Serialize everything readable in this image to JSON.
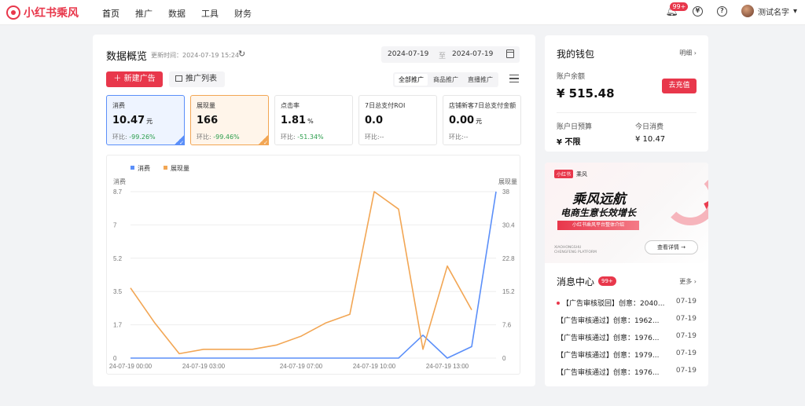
{
  "app": {
    "logo_text": "小红书乘风",
    "brand_color": "#e8374b"
  },
  "nav": {
    "items": [
      "首页",
      "推广",
      "数据",
      "工具",
      "财务"
    ]
  },
  "header": {
    "notification_count": "99+",
    "user_name": "测试名字"
  },
  "overview": {
    "title": "数据概览",
    "update_time": "更新时间：2024-07-19 15:24",
    "date_start": "2024-07-19",
    "date_sep": "至",
    "date_end": "2024-07-19",
    "new_ad_label": "新建广告",
    "promo_list_label": "推广列表",
    "filters": [
      "全部推广",
      "商品推广",
      "直播推广"
    ]
  },
  "metrics": [
    {
      "label": "消费",
      "value": "10.47",
      "unit": "元",
      "compare_label": "环比:",
      "compare_value": "-99.26%"
    },
    {
      "label": "展现量",
      "value": "166",
      "unit": "",
      "compare_label": "环比:",
      "compare_value": "-99.46%"
    },
    {
      "label": "点击率",
      "value": "1.81",
      "unit": "%",
      "compare_label": "环比:",
      "compare_value": "-51.34%"
    },
    {
      "label": "7日总支付ROI",
      "value": "0.0",
      "unit": "",
      "compare_label": "环比:",
      "compare_value": "--"
    },
    {
      "label": "店铺新客7日总支付金额",
      "value": "0.00",
      "unit": "元",
      "compare_label": "环比:",
      "compare_value": "--"
    }
  ],
  "chart_data": {
    "type": "line",
    "x": [
      "24-07-19 00:00",
      "24-07-19 01:00",
      "24-07-19 02:00",
      "24-07-19 03:00",
      "24-07-19 04:00",
      "24-07-19 05:00",
      "24-07-19 06:00",
      "24-07-19 07:00",
      "24-07-19 08:00",
      "24-07-19 09:00",
      "24-07-19 10:00",
      "24-07-19 11:00",
      "24-07-19 12:00",
      "24-07-19 13:00",
      "24-07-19 14:00",
      "24-07-19 15:00"
    ],
    "x_tick_labels": [
      "24-07-19 00:00",
      "24-07-19 03:00",
      "24-07-19 07:00",
      "24-07-19 10:00",
      "24-07-19 13:00"
    ],
    "x_tick_indices": [
      0,
      3,
      7,
      10,
      13
    ],
    "series": [
      {
        "name": "消费",
        "axis": "left",
        "color": "#5b8ff9",
        "values": [
          0,
          0,
          0,
          0,
          0,
          0,
          0,
          0,
          0,
          0,
          0,
          0,
          1.2,
          0,
          0.6,
          8.7
        ]
      },
      {
        "name": "展现量",
        "axis": "right",
        "color": "#f2a654",
        "values": [
          16,
          8,
          1,
          2,
          2,
          2,
          3,
          5,
          8,
          10,
          38,
          34,
          2,
          21,
          11
        ]
      }
    ],
    "ylabel_left": "消费",
    "ylabel_right": "展现量",
    "yticks_left": [
      "0",
      "1.7",
      "3.5",
      "5.2",
      "7",
      "8.7"
    ],
    "yticks_right": [
      "0",
      "7.6",
      "15.2",
      "22.8",
      "30.4",
      "38"
    ],
    "ylim_left": [
      0,
      8.7
    ],
    "ylim_right": [
      0,
      38
    ],
    "legend_position": "top-left",
    "grid": true
  },
  "wallet": {
    "title": "我的钱包",
    "detail_label": "明细",
    "balance_label": "账户余额",
    "balance_value": "¥ 515.48",
    "charge_label": "去充值",
    "daily_budget_label": "账户日预算",
    "daily_budget_value": "¥ 不限",
    "today_spend_label": "今日消费",
    "today_spend_value": "¥ 10.47"
  },
  "banner": {
    "tag_left": "小红书",
    "tag_right": "乘风",
    "headline": "乘风远航",
    "subline": "电商生意长效增长",
    "strip_text": "小红书乘风平台整体介绍",
    "english_line1": "XIAOHONGSHU",
    "english_line2": "CHENGFENG PLATFORM",
    "more_label": "查看详情"
  },
  "messages": {
    "title": "消息中心",
    "badge": "99+",
    "more_label": "更多",
    "items": [
      {
        "text": "【广告审核驳回】创意：2040...",
        "date": "07-19",
        "unread": true
      },
      {
        "text": "【广告审核通过】创意：1962...",
        "date": "07-19",
        "unread": false
      },
      {
        "text": "【广告审核通过】创意：1976...",
        "date": "07-19",
        "unread": false
      },
      {
        "text": "【广告审核通过】创意：1979...",
        "date": "07-19",
        "unread": false
      },
      {
        "text": "【广告审核通过】创意：1976...",
        "date": "07-19",
        "unread": false
      }
    ]
  }
}
